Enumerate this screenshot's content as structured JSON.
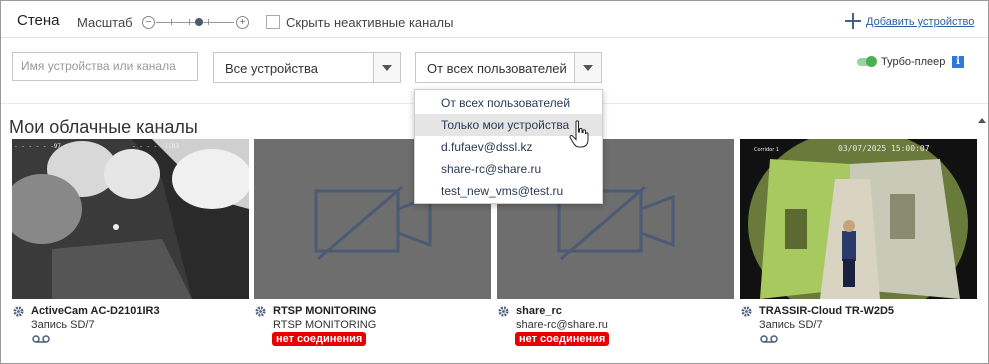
{
  "header": {
    "title": "Стена",
    "zoom_label": "Масштаб",
    "zoom_minus": "−",
    "zoom_plus": "+",
    "zoom_level": 0.55,
    "hide_inactive_label": "Скрыть неактивные каналы",
    "hide_inactive_checked": false,
    "add_device_label": "Добавить устройство"
  },
  "filters": {
    "search_placeholder": "Имя устройства или канала",
    "devices_select": "Все устройства",
    "users_select": "От всех пользователей",
    "turbo_label": "Турбо-плеер",
    "turbo_on": true,
    "info_glyph": "i"
  },
  "users_dropdown": {
    "options": [
      "От всех пользователей",
      "Только мои устройства",
      "d.fufaev@dssl.kz",
      "share-rc@share.ru",
      "test_new_vms@test.ru"
    ],
    "highlighted_index": 1
  },
  "section_title": "Мои облачные каналы",
  "channels": [
    {
      "name": "ActiveCam AC-D2101IR3",
      "subtitle": "Запись SD/7",
      "status": "",
      "icon": "recording-icon"
    },
    {
      "name": "RTSP MONITORING",
      "subtitle": "RTSP MONITORING",
      "status": "нет соединения",
      "icon": "no-video-icon"
    },
    {
      "name": "share_rc",
      "subtitle": "share-rc@share.ru",
      "status": "нет соединения",
      "icon": "no-video-icon"
    },
    {
      "name": "TRASSIR-Cloud TR-W2D5",
      "subtitle": "Запись SD/7",
      "status": "",
      "icon": "recording-icon",
      "timestamp": "03/07/2025 15:00:07",
      "overlay_label": "Corridor 1"
    }
  ],
  "colors": {
    "accent": "#2a5ea5",
    "offline_badge": "#e80000",
    "turbo_toggle": "#4caf50",
    "tile_gray": "#6e6e6e",
    "icon_blue": "#4b5f7e"
  }
}
